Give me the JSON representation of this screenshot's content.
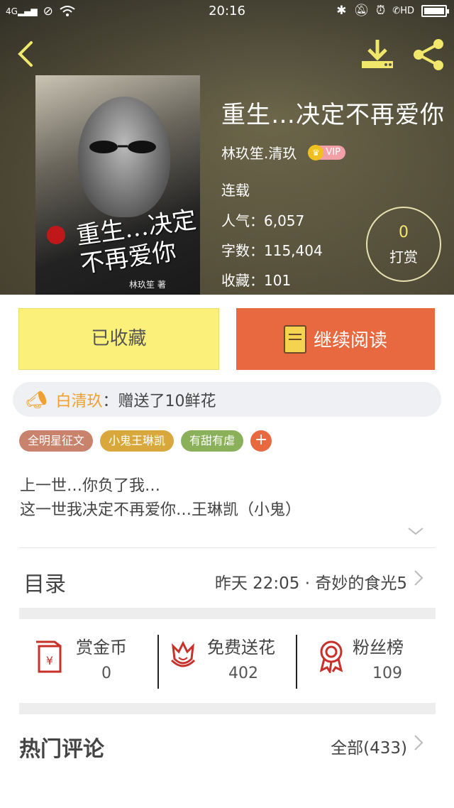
{
  "status_bar": {
    "network": "4G",
    "time": "20:16",
    "hd_label": "HD"
  },
  "book": {
    "title": "重生…决定不再爱你",
    "author": "林玖笙.清玖",
    "vip_label": "VIP",
    "status": "连载",
    "popularity_label": "人气：",
    "popularity": "6,057",
    "words_label": "字数：",
    "words": "115,404",
    "favorites_label": "收藏：",
    "favorites": "101",
    "cover_title": "重生…决定不再爱你",
    "cover_author": "林玖笙 著"
  },
  "tip": {
    "count": "0",
    "label": "打赏"
  },
  "actions": {
    "favorite_label": "已收藏",
    "read_label": "继续阅读"
  },
  "gift": {
    "who": "白清玖",
    "message": "：赠送了10鲜花"
  },
  "tags": [
    "全明星征文",
    "小鬼王琳凯",
    "有甜有虐"
  ],
  "tag_add": "+",
  "description": {
    "line1": "上一世…你负了我…",
    "line2": "这一世我决定不再爱你…王琳凯（小鬼）"
  },
  "toc": {
    "label": "目录",
    "latest": "昨天 22:05 · 奇妙的食光5"
  },
  "stats": [
    {
      "name": "赏金币",
      "value": "0"
    },
    {
      "name": "免费送花",
      "value": "402"
    },
    {
      "name": "粉丝榜",
      "value": "109"
    }
  ],
  "comments": {
    "label": "热门评论",
    "all": "全部(433)"
  },
  "colors": {
    "accent_orange": "#e8683f",
    "accent_yellow": "#fbf17a",
    "icon_red": "#c8302a",
    "header_icon_yellow": "#f1e86b"
  }
}
